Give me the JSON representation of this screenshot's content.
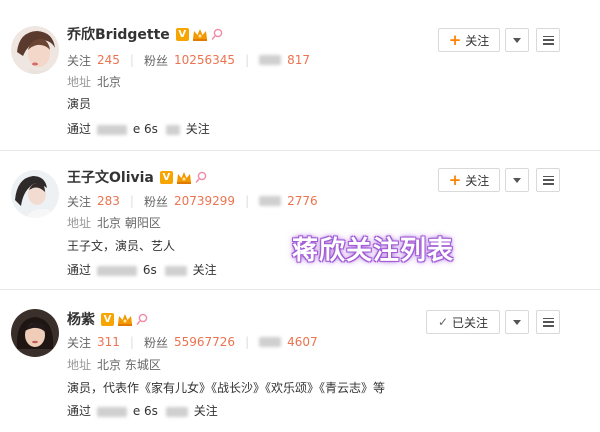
{
  "users": [
    {
      "name": "乔欣Bridgette",
      "follow_label": "关注",
      "follow_count": "245",
      "fans_label": "粉丝",
      "fans_count": "10256345",
      "weibo_count": "817",
      "address_label": "地址",
      "address": "北京",
      "description": "演员",
      "via_prefix": "通过",
      "via_text": "e 6s",
      "via_suffix": "关注",
      "button_label": "关注",
      "button_state": "follow"
    },
    {
      "name": "王子文Olivia",
      "follow_label": "关注",
      "follow_count": "283",
      "fans_label": "粉丝",
      "fans_count": "20739299",
      "weibo_count": "2776",
      "address_label": "地址",
      "address": "北京 朝阳区",
      "description": "王子文，演员、艺人",
      "via_prefix": "通过",
      "via_text": "6s",
      "via_suffix": "关注",
      "button_label": "关注",
      "button_state": "follow"
    },
    {
      "name": "杨紫",
      "follow_label": "关注",
      "follow_count": "311",
      "fans_label": "粉丝",
      "fans_count": "55967726",
      "weibo_count": "4607",
      "address_label": "地址",
      "address": "北京 东城区",
      "description": "演员，代表作《家有儿女》《战长沙》《欢乐颂》《青云志》等",
      "via_prefix": "通过",
      "via_text": "e 6s",
      "via_suffix": "关注",
      "button_label": "已关注",
      "button_state": "followed"
    }
  ],
  "overlay_text": "蒋欣关注列表",
  "colors": {
    "count_orange": "#eb7350",
    "plus_orange": "#ff8200",
    "badge_gold": "#f7a500",
    "overlay_purple": "#a25bd6"
  }
}
